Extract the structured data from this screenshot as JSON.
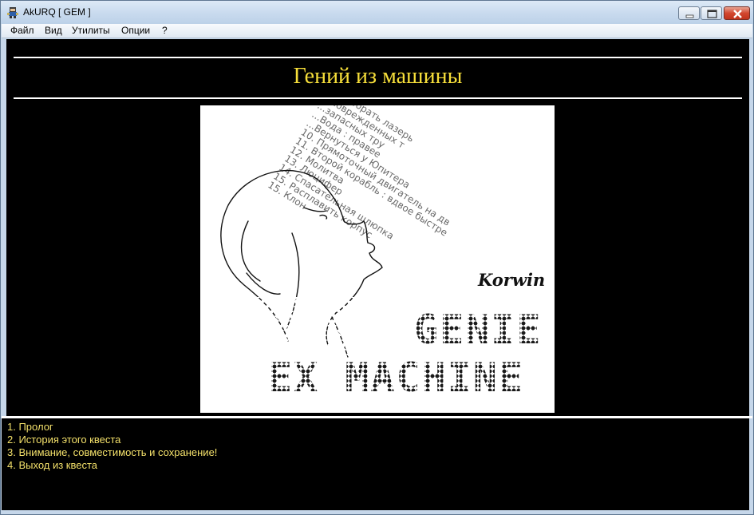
{
  "window": {
    "title": "AkURQ [ GEM ]"
  },
  "menubar": {
    "items": [
      "Файл",
      "Вид",
      "Утилиты",
      "Опции",
      "?"
    ]
  },
  "content": {
    "title": "Гений из машины",
    "cover": {
      "author": "Korwin",
      "line1": "GENIE",
      "line2": "EX MACHINE",
      "list": [
        "...разобрать лазерь",
        "...поврежденных т",
        "...запасных тру",
        "...Вода : правее",
        "...Вернуться у Юпитера",
        "10. Прямоточный двигатель на дв",
        "11. Второй корабль : вдвое быстре",
        "12. Молитва",
        "13. Люцифер",
        "14. Спасательная шлюпка",
        "15. Расплавить корпус",
        "15. Клон"
      ]
    }
  },
  "choices": [
    "1. Пролог",
    "2. История этого квеста",
    "3. Внимание, совместимость и сохранение!",
    "4. Выход из квеста"
  ],
  "colors": {
    "title": "#f7df3a",
    "choice": "#f3e06a",
    "background": "#000000"
  },
  "icons": {
    "app": "app-icon",
    "minimize": "minimize-icon",
    "maximize": "maximize-icon",
    "close": "close-icon"
  }
}
